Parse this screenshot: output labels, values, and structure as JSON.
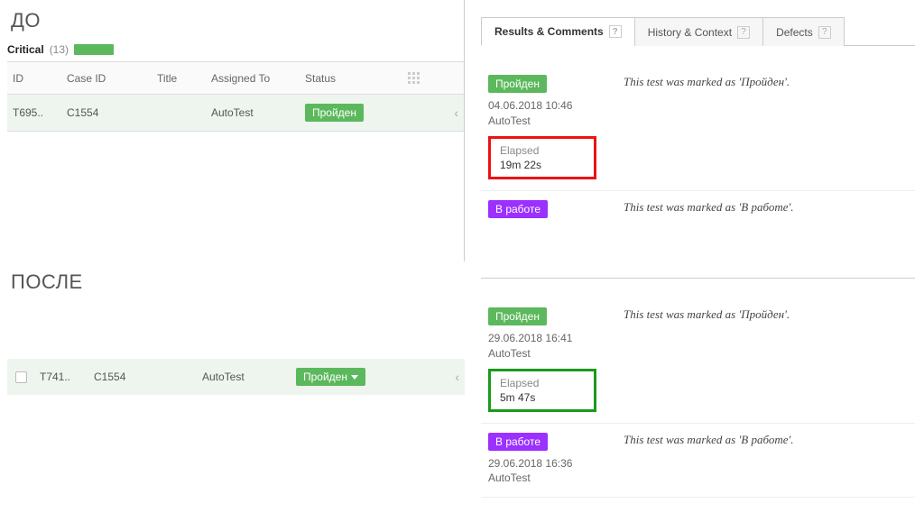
{
  "before": {
    "heading": "ДО",
    "group": {
      "label": "Critical",
      "count": "(13)"
    },
    "columns": {
      "id": "ID",
      "case": "Case ID",
      "title": "Title",
      "assigned": "Assigned To",
      "status": "Status"
    },
    "row": {
      "id": "T695..",
      "case": "C1554",
      "title": "",
      "assigned": "AutoTest",
      "status": "Пройден"
    },
    "tabs": {
      "results": "Results & Comments",
      "history": "History & Context",
      "defects": "Defects"
    },
    "changes": [
      {
        "badge_type": "pass",
        "badge": "Пройден",
        "timestamp": "04.06.2018 10:46",
        "user": "AutoTest",
        "elapsed_label": "Elapsed",
        "elapsed_value": "19m 22s",
        "elapsed_color": "red",
        "message": "This test was marked as 'Пройден'."
      },
      {
        "badge_type": "work",
        "badge": "В работе",
        "message": "This test was marked as 'В работе'."
      }
    ]
  },
  "after": {
    "heading": "ПОСЛЕ",
    "row": {
      "id": "T741..",
      "case": "C1554",
      "title": "",
      "assigned": "AutoTest",
      "status": "Пройден"
    },
    "changes": [
      {
        "badge_type": "pass",
        "badge": "Пройден",
        "timestamp": "29.06.2018 16:41",
        "user": "AutoTest",
        "elapsed_label": "Elapsed",
        "elapsed_value": "5m 47s",
        "elapsed_color": "green",
        "message": "This test was marked as 'Пройден'."
      },
      {
        "badge_type": "work",
        "badge": "В работе",
        "timestamp": "29.06.2018 16:36",
        "user": "AutoTest",
        "message": "This test was marked as 'В работе'."
      }
    ]
  }
}
